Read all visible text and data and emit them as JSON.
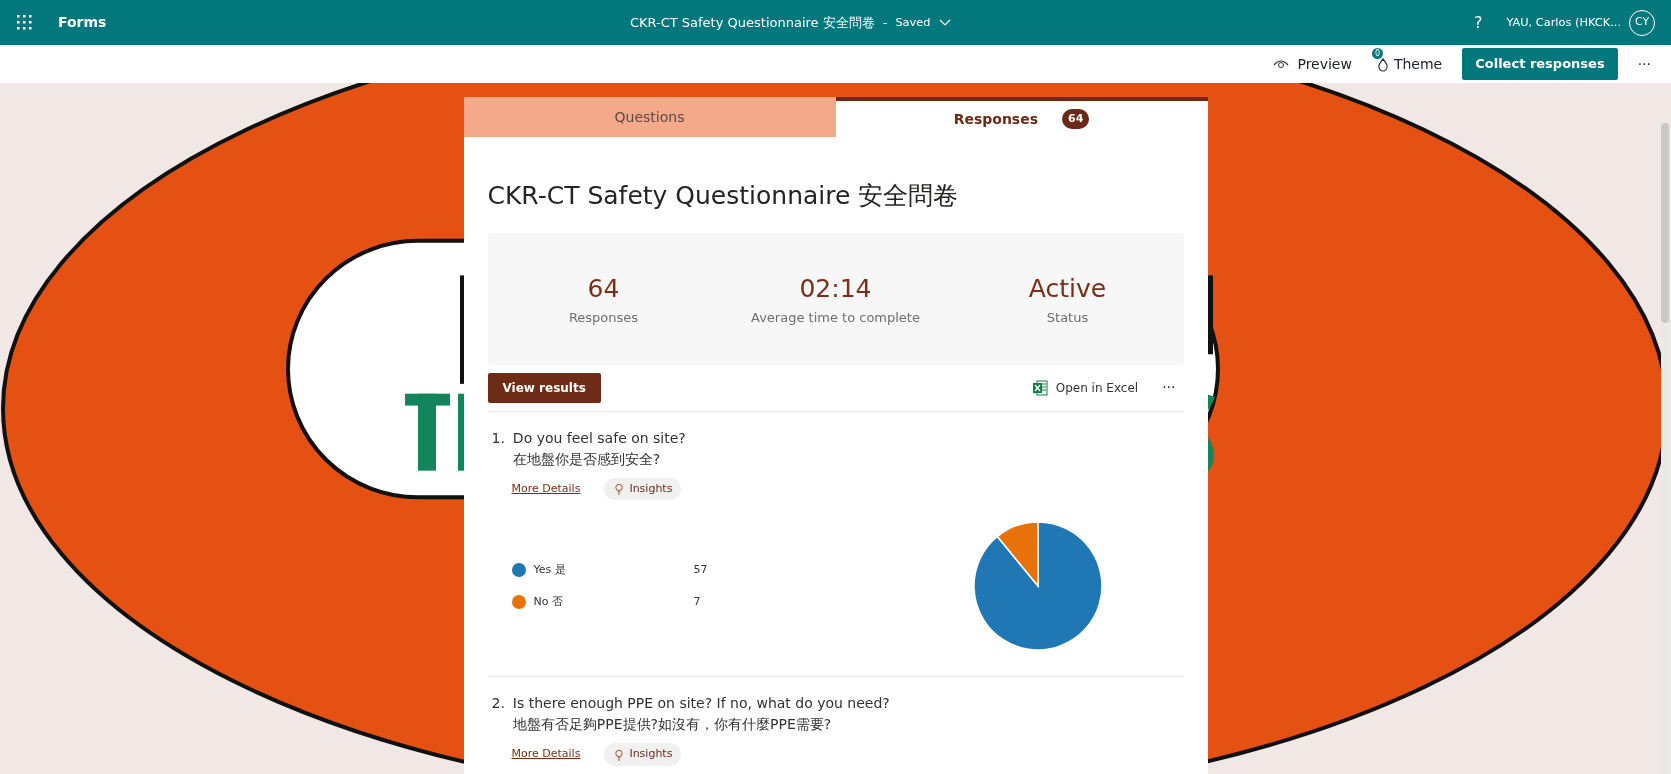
{
  "app_bar": {
    "app_name": "Forms",
    "form_title": "CKR-CT Safety Questionnaire 安全問卷",
    "separator": "-",
    "save_state": "Saved",
    "help": "?",
    "user_name": "YAU, Carlos (HKCK...",
    "user_initials": "CY"
  },
  "toolbar": {
    "preview": "Preview",
    "theme": "Theme",
    "theme_badge": "0",
    "collect": "Collect responses",
    "more": "···"
  },
  "tabs": [
    {
      "label": "Questions",
      "selected": false
    },
    {
      "label": "Responses",
      "selected": true,
      "count": "64"
    }
  ],
  "title": "CKR-CT Safety Questionnaire 安全問卷",
  "stats": [
    {
      "value": "64",
      "label": "Responses"
    },
    {
      "value": "02:14",
      "label": "Average time to complete"
    },
    {
      "value": "Active",
      "label": "Status"
    }
  ],
  "actions": {
    "view_results": "View results",
    "open_excel": "Open in Excel",
    "more": "···"
  },
  "questions": [
    {
      "number": "1.",
      "text": "Do you feel safe on site?",
      "text_zh": "在地盤你是否感到安全?",
      "more_details": "More Details",
      "insights": "Insights",
      "options": [
        {
          "count": "57",
          "color": "#1f77b4"
        },
        {
          "count": "7",
          "color": "#e8710a"
        }
      ],
      "chart_data": {
        "type": "pie",
        "categories": [
          "Yes 是",
          "No 否"
        ],
        "values": [
          89.06,
          10.94
        ]
      }
    },
    {
      "number": "2.",
      "text": "Is there enough PPE on site? If no, what do you need?",
      "text_zh": "地盤有否足夠PPE提供?如沒有，你有什麼PPE需要?",
      "more_details": "More Details",
      "insights": "Insights"
    }
  ]
}
